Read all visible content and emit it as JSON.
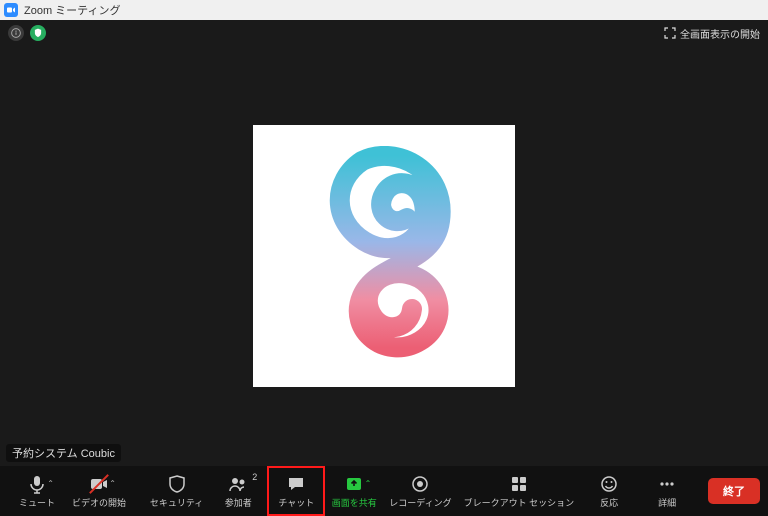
{
  "window": {
    "title": "Zoom ミーティング"
  },
  "topbar": {
    "fullscreen_label": "全画面表示の開始"
  },
  "participant": {
    "name": "予約システム Coubic"
  },
  "toolbar": {
    "mute": "ミュート",
    "video": "ビデオの開始",
    "security": "セキュリティ",
    "participants": "参加者",
    "participants_count": "2",
    "chat": "チャット",
    "share": "画面を共有",
    "recording": "レコーディング",
    "breakout": "ブレークアウト セッション",
    "reactions": "反応",
    "more": "詳細",
    "end": "終了"
  }
}
